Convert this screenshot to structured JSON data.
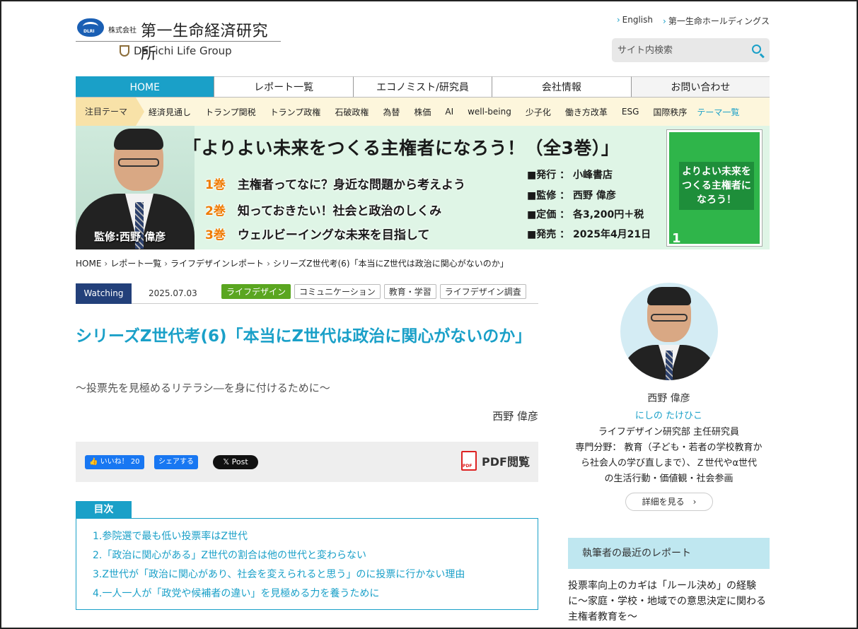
{
  "header": {
    "logo_badge": "DLRI",
    "logo_kabushiki": "株式会社",
    "logo_name": "第一生命経済研究所",
    "group_name": "Dai-ichi Life Group",
    "top_links": [
      "English",
      "第一生命ホールディングス"
    ],
    "search_placeholder": "サイト内検索"
  },
  "nav": {
    "items": [
      "HOME",
      "レポート一覧",
      "エコノミスト/研究員",
      "会社情報",
      "お問い合わせ"
    ],
    "active": "HOME"
  },
  "themes": {
    "label": "注目テーマ",
    "items": [
      "経済見通し",
      "トランプ関税",
      "トランプ政権",
      "石破政権",
      "為替",
      "株価",
      "AI",
      "well-being",
      "少子化",
      "働き方改革",
      "ESG",
      "国際秩序"
    ],
    "more": "テーマ一覧"
  },
  "banner": {
    "caption": "監修:西野 偉彦",
    "title": "「よりよい未来をつくる主権者になろう！（全3巻）」",
    "volumes": [
      {
        "no": "1巻",
        "text": "主権者ってなに？身近な問題から考えよう"
      },
      {
        "no": "2巻",
        "text": "知っておきたい！社会と政治のしくみ"
      },
      {
        "no": "3巻",
        "text": "ウェルビーイングな未来を目指して"
      }
    ],
    "info": [
      "■発行 ： 小峰書店",
      "■監修 ： 西野 偉彦",
      "■定価 ： 各3,200円＋税",
      "■発売 ： 2025年4月21日"
    ],
    "book_title": "よりよい未来をつくる主権者になろう！",
    "book_number": "1"
  },
  "breadcrumb": [
    "HOME",
    "レポート一覧",
    "ライフデザインレポート",
    "シリーズZ世代考(6)「本当にZ世代は政治に関心がないのか」"
  ],
  "article": {
    "category": "Watching",
    "date": "2025.07.03",
    "tags": [
      "ライフデザイン",
      "コミュニケーション",
      "教育・学習",
      "ライフデザイン調査"
    ],
    "title": "シリーズZ世代考(6)「本当にZ世代は政治に関心がないのか」",
    "subtitle": "〜投票先を見極めるリテラシ―を身に付けるために〜",
    "author": "西野 偉彦",
    "share": {
      "like": "いいね！ 20",
      "share": "シェアする",
      "post": "Post",
      "pdf": "PDF閲覧"
    }
  },
  "toc": {
    "label": "目次",
    "items": [
      "1.参院選で最も低い投票率はZ世代",
      "2.「政治に関心がある」Z世代の割合は他の世代と変わらない",
      "3.Z世代が「政治に関心があり、社会を変えられると思う」のに投票に行かない理由",
      "4.一人一人が「政党や候補者の違い」を見極める力を養うために"
    ]
  },
  "sidebar": {
    "name": "西野 偉彦",
    "kana": "にしの たけひこ",
    "position": "ライフデザイン研究部 主任研究員",
    "specialty": [
      "専門分野： 教育（子ども・若者の学校教育か",
      "ら社会人の学び直しまで）、Ｚ世代やα世代",
      "の生活行動・価値観・社会参画"
    ],
    "detail_button": "詳細を見る",
    "recent_heading": "執筆者の最近のレポート",
    "recent_item": "投票率向上のカギは「ルール決め」の経験に〜家庭・学校・地域での意思決定に関わる主権者教育を〜"
  }
}
